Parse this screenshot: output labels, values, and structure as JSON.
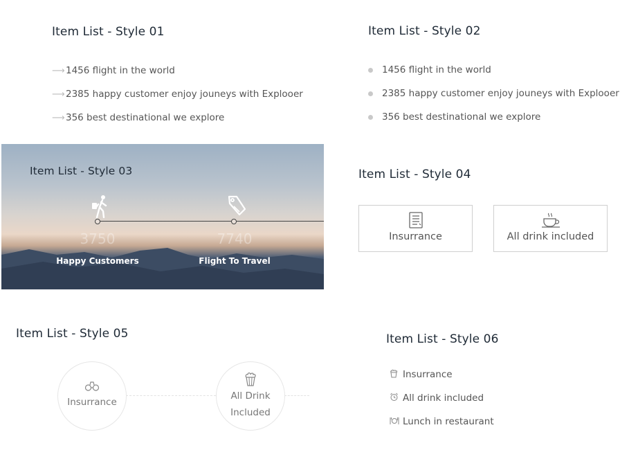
{
  "style01": {
    "title": "Item List - Style 01",
    "items": [
      "1456 flight in the world",
      "2385 happy customer enjoy jouneys with Explooer",
      "356 best destinational we explore"
    ]
  },
  "style02": {
    "title": "Item List - Style 02",
    "items": [
      "1456 flight in the world",
      "2385 happy customer enjoy jouneys with Explooer",
      "356 best destinational we explore"
    ]
  },
  "style03": {
    "title": "Item List - Style 03",
    "items": [
      {
        "number": "3750",
        "label": "Happy Customers",
        "icon": "hiker-icon"
      },
      {
        "number": "7740",
        "label": "Flight To Travel",
        "icon": "luggage-tag-icon"
      }
    ]
  },
  "style04": {
    "title": "Item List - Style 04",
    "items": [
      {
        "label": "Insurrance",
        "icon": "document-icon"
      },
      {
        "label": "All drink included",
        "icon": "coffee-cup-icon"
      }
    ]
  },
  "style05": {
    "title": "Item List - Style 05",
    "items": [
      {
        "label": "Insurrance",
        "icon": "binoculars-icon"
      },
      {
        "label_line1": "All Drink",
        "label_line2": "Included",
        "icon": "popcorn-icon"
      }
    ]
  },
  "style06": {
    "title": "Item List - Style 06",
    "items": [
      {
        "label": "Insurrance",
        "icon": "popcorn-icon"
      },
      {
        "label": "All drink included",
        "icon": "alarm-clock-icon"
      },
      {
        "label": "Lunch in restaurant",
        "icon": "dining-icon"
      }
    ]
  },
  "colors": {
    "title": "#1f2a36",
    "text": "#555555",
    "border": "#cfcfcf"
  }
}
